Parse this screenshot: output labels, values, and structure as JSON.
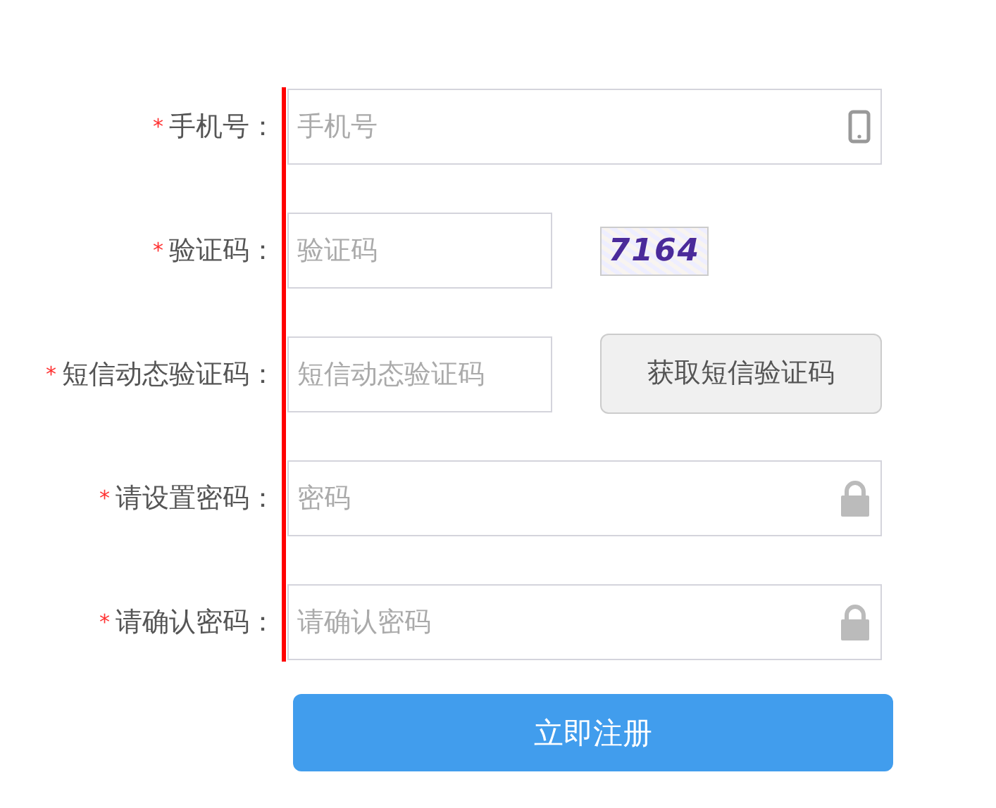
{
  "fields": [
    {
      "kind": "phone",
      "asterisk": "*",
      "label": "手机号",
      "placeholder": "手机号"
    },
    {
      "kind": "captcha",
      "asterisk": "*",
      "label": "验证码",
      "placeholder": "验证码",
      "captcha": "7164"
    },
    {
      "kind": "sms",
      "asterisk": "*",
      "label": "短信动态验证码",
      "placeholder": "短信动态验证码",
      "button": "获取短信验证码"
    },
    {
      "kind": "lock",
      "asterisk": "*",
      "label": "请设置密码",
      "placeholder": "密码"
    },
    {
      "kind": "lock",
      "asterisk": "*",
      "label": "请确认密码",
      "placeholder": "请确认密码"
    }
  ],
  "separator": "：",
  "submit": "立即注册"
}
